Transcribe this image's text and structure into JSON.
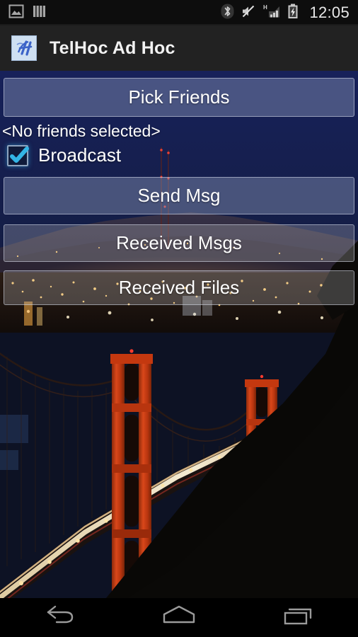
{
  "status_bar": {
    "left_icons": [
      {
        "name": "image-icon",
        "label": "Screenshot / image notification"
      },
      {
        "name": "equalizer-bars-icon",
        "label": "Media bars notification"
      }
    ],
    "right_icons": [
      {
        "name": "bluetooth-icon",
        "label": "Bluetooth on"
      },
      {
        "name": "volume-mute-icon",
        "label": "Ringer muted"
      },
      {
        "name": "signal-h-icon",
        "label": "H network signal",
        "network_type": "H"
      },
      {
        "name": "battery-charging-icon",
        "label": "Battery charging"
      }
    ],
    "clock": "12:05"
  },
  "action_bar": {
    "icon_name": "telhoc-app-icon",
    "title": "TelHoc Ad Hoc"
  },
  "main": {
    "pick_friends_label": "Pick Friends",
    "friends_status": "<No friends selected>",
    "broadcast_label": "Broadcast",
    "broadcast_checked": true,
    "send_msg_label": "Send Msg",
    "received_msgs_label": "Received Msgs",
    "received_files_label": "Received Files"
  },
  "wallpaper": {
    "description": "Golden Gate Bridge at night",
    "sky_color": "#16204c",
    "bridge_color": "#c4380f",
    "hill_color": "#0b0906",
    "city_light_color": "#ffcc66"
  },
  "nav_bar": {
    "buttons": [
      {
        "name": "back-button",
        "label": "Back"
      },
      {
        "name": "home-button",
        "label": "Home"
      },
      {
        "name": "recents-button",
        "label": "Recent apps"
      }
    ]
  },
  "colors": {
    "action_bar_bg": "#222222",
    "status_bar_bg": "#0d0d0d",
    "accent_checkbox": "#33b5e5",
    "text_primary": "#ffffff"
  }
}
